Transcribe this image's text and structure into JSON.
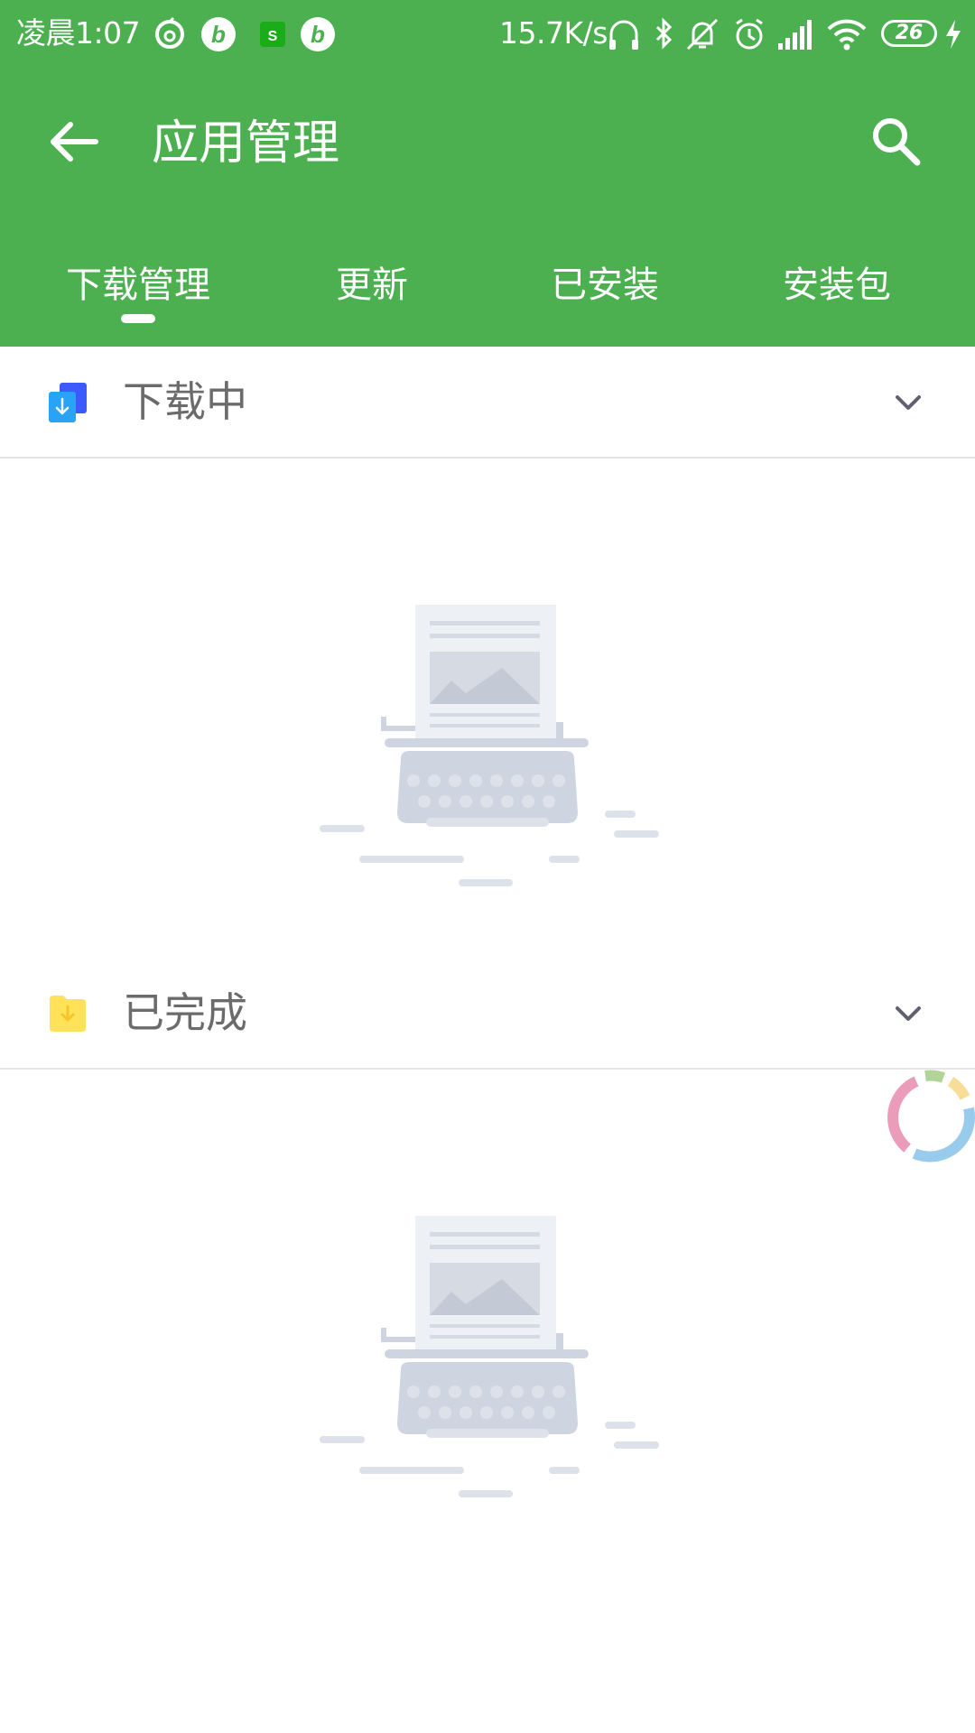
{
  "status_bar": {
    "time": "凌晨1:07",
    "net_speed": "15.7K/s",
    "battery": "26",
    "notification_icons": [
      "netease-music-icon",
      "bilibili-icon",
      "shopping-app-icon",
      "bilibili-icon"
    ],
    "system_icons": [
      "headphones-icon",
      "bluetooth-icon",
      "mute-icon",
      "alarm-icon",
      "signal-icon",
      "wifi-icon",
      "battery-icon",
      "charging-icon"
    ]
  },
  "toolbar": {
    "title": "应用管理",
    "back_icon": "arrow-back-icon",
    "search_icon": "search-icon"
  },
  "tabs": [
    {
      "label": "下载管理",
      "selected": true
    },
    {
      "label": "更新",
      "selected": false
    },
    {
      "label": "已安装",
      "selected": false
    },
    {
      "label": "安装包",
      "selected": false
    }
  ],
  "sections": [
    {
      "label": "下载中",
      "icon": "downloading-icon",
      "expanded_icon": "chevron-down-icon"
    },
    {
      "label": "已完成",
      "icon": "completed-folder-icon",
      "expanded_icon": "chevron-down-icon"
    }
  ],
  "colors": {
    "header_green": "#4caf50",
    "text_gray": "#6b6b6b",
    "divider": "#e4e4e6",
    "illustration_gray": "#ced5e0"
  }
}
